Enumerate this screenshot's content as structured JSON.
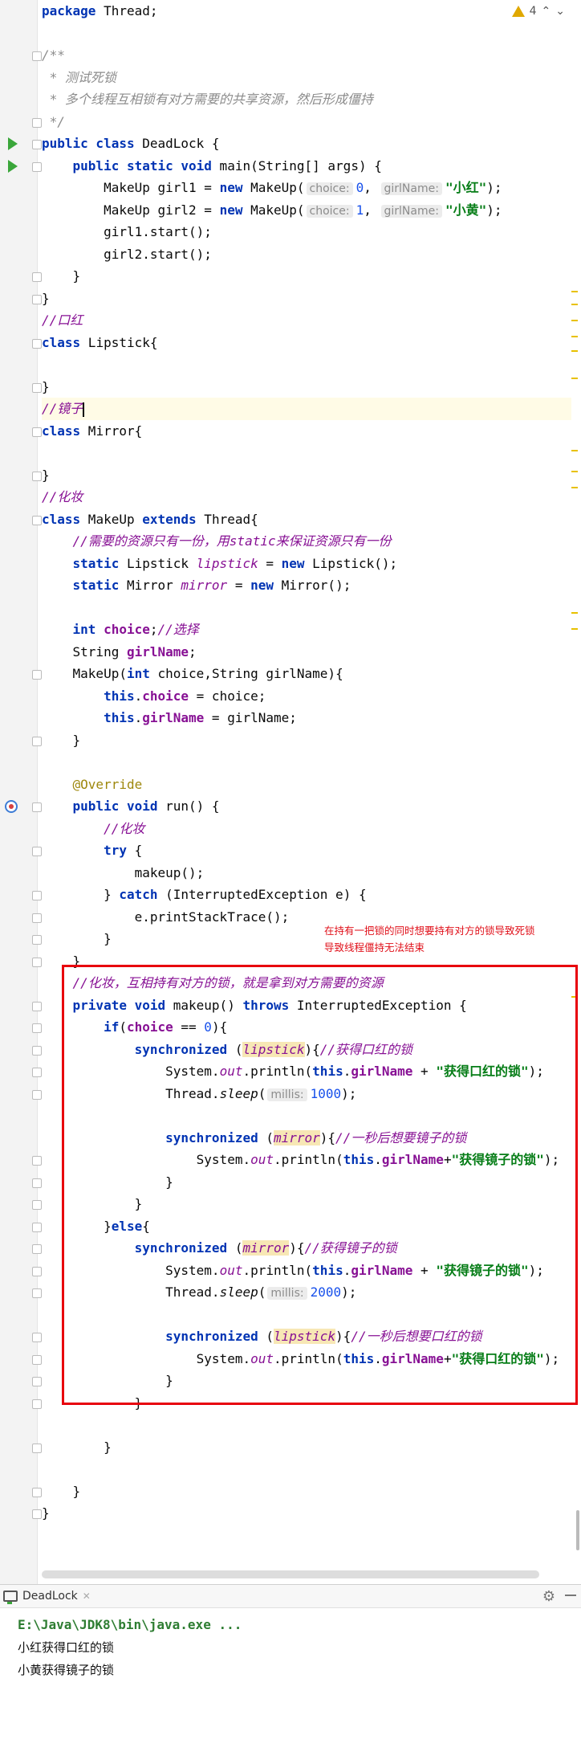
{
  "editor": {
    "warning_count": "4",
    "lines": [
      [
        {
          "t": "package",
          "c": "kw"
        },
        {
          "t": " Thread;"
        }
      ],
      [],
      [
        {
          "t": "/**",
          "c": "cm"
        }
      ],
      [
        {
          "t": " * 测试死锁",
          "c": "cm"
        }
      ],
      [
        {
          "t": " * 多个线程互相锁有对方需要的共享资源，然后形成僵持",
          "c": "cm"
        }
      ],
      [
        {
          "t": " */",
          "c": "cm"
        }
      ],
      [
        {
          "t": "public class",
          "c": "kw"
        },
        {
          "t": " DeadLock {"
        }
      ],
      [
        {
          "t": "    "
        },
        {
          "t": "public static void",
          "c": "kw"
        },
        {
          "t": " main(String[] args) {"
        }
      ],
      [
        {
          "t": "        MakeUp girl1 = "
        },
        {
          "t": "new",
          "c": "kw"
        },
        {
          "t": " MakeUp("
        },
        {
          "t": "choice:",
          "c": "hint"
        },
        {
          "t": "0",
          "c": "num"
        },
        {
          "t": ", "
        },
        {
          "t": "girlName:",
          "c": "hint"
        },
        {
          "t": "\"小红\"",
          "c": "str"
        },
        {
          "t": ");"
        }
      ],
      [
        {
          "t": "        MakeUp girl2 = "
        },
        {
          "t": "new",
          "c": "kw"
        },
        {
          "t": " MakeUp("
        },
        {
          "t": "choice:",
          "c": "hint"
        },
        {
          "t": "1",
          "c": "num"
        },
        {
          "t": ", "
        },
        {
          "t": "girlName:",
          "c": "hint"
        },
        {
          "t": "\"小黄\"",
          "c": "str"
        },
        {
          "t": ");"
        }
      ],
      [
        {
          "t": "        girl1.start();"
        }
      ],
      [
        {
          "t": "        girl2.start();"
        }
      ],
      [
        {
          "t": "    }"
        }
      ],
      [
        {
          "t": "}"
        }
      ],
      [
        {
          "t": "//口红",
          "c": "cmp"
        }
      ],
      [
        {
          "t": "class",
          "c": "kw"
        },
        {
          "t": " Lipstick{"
        }
      ],
      [],
      [
        {
          "t": "}"
        }
      ],
      [
        {
          "t": "//镜子",
          "c": "cmp"
        }
      ],
      [
        {
          "t": "class",
          "c": "kw"
        },
        {
          "t": " Mirror{"
        }
      ],
      [],
      [
        {
          "t": "}"
        }
      ],
      [
        {
          "t": "//化妆",
          "c": "cmp"
        }
      ],
      [
        {
          "t": "class",
          "c": "kw"
        },
        {
          "t": " MakeUp "
        },
        {
          "t": "extends",
          "c": "kw"
        },
        {
          "t": " Thread{"
        }
      ],
      [
        {
          "t": "    "
        },
        {
          "t": "//需要的资源只有一份，用static来保证资源只有一份",
          "c": "cmp"
        }
      ],
      [
        {
          "t": "    "
        },
        {
          "t": "static",
          "c": "kw"
        },
        {
          "t": " Lipstick "
        },
        {
          "t": "lipstick",
          "c": "sfld"
        },
        {
          "t": " = "
        },
        {
          "t": "new",
          "c": "kw"
        },
        {
          "t": " Lipstick();"
        }
      ],
      [
        {
          "t": "    "
        },
        {
          "t": "static",
          "c": "kw"
        },
        {
          "t": " Mirror "
        },
        {
          "t": "mirror",
          "c": "sfld"
        },
        {
          "t": " = "
        },
        {
          "t": "new",
          "c": "kw"
        },
        {
          "t": " Mirror();"
        }
      ],
      [],
      [
        {
          "t": "    "
        },
        {
          "t": "int",
          "c": "kw"
        },
        {
          "t": " "
        },
        {
          "t": "choice",
          "c": "fld"
        },
        {
          "t": ";"
        },
        {
          "t": "//选择",
          "c": "cmp"
        }
      ],
      [
        {
          "t": "    String "
        },
        {
          "t": "girlName",
          "c": "fld"
        },
        {
          "t": ";"
        }
      ],
      [
        {
          "t": "    MakeUp("
        },
        {
          "t": "int",
          "c": "kw"
        },
        {
          "t": " choice,String girlName){"
        }
      ],
      [
        {
          "t": "        "
        },
        {
          "t": "this",
          "c": "kw"
        },
        {
          "t": "."
        },
        {
          "t": "choice",
          "c": "fld"
        },
        {
          "t": " = choice;"
        }
      ],
      [
        {
          "t": "        "
        },
        {
          "t": "this",
          "c": "kw"
        },
        {
          "t": "."
        },
        {
          "t": "girlName",
          "c": "fld"
        },
        {
          "t": " = girlName;"
        }
      ],
      [
        {
          "t": "    }"
        }
      ],
      [],
      [
        {
          "t": "    "
        },
        {
          "t": "@Override",
          "c": "ann"
        }
      ],
      [
        {
          "t": "    "
        },
        {
          "t": "public void",
          "c": "kw"
        },
        {
          "t": " run() {"
        }
      ],
      [
        {
          "t": "        "
        },
        {
          "t": "//化妆",
          "c": "cmp"
        }
      ],
      [
        {
          "t": "        "
        },
        {
          "t": "try",
          "c": "kw"
        },
        {
          "t": " {"
        }
      ],
      [
        {
          "t": "            makeup();"
        }
      ],
      [
        {
          "t": "        } "
        },
        {
          "t": "catch",
          "c": "kw"
        },
        {
          "t": " (InterruptedException e) {"
        }
      ],
      [
        {
          "t": "            e.printStackTrace();"
        }
      ],
      [
        {
          "t": "        }"
        }
      ],
      [
        {
          "t": "    }"
        }
      ],
      [
        {
          "t": "    "
        },
        {
          "t": "//化妆，互相持有对方的锁，就是拿到对方需要的资源",
          "c": "cmp"
        }
      ],
      [
        {
          "t": "    "
        },
        {
          "t": "private void",
          "c": "kw"
        },
        {
          "t": " makeup() "
        },
        {
          "t": "throws",
          "c": "kw"
        },
        {
          "t": " InterruptedException {"
        }
      ],
      [
        {
          "t": "        "
        },
        {
          "t": "if",
          "c": "kw"
        },
        {
          "t": "("
        },
        {
          "t": "choice",
          "c": "fld"
        },
        {
          "t": " == "
        },
        {
          "t": "0",
          "c": "num"
        },
        {
          "t": "){"
        }
      ],
      [
        {
          "t": "            "
        },
        {
          "t": "synchronized",
          "c": "kw"
        },
        {
          "t": " ("
        },
        {
          "t": "lipstick",
          "c": "sfld hl"
        },
        {
          "t": "){"
        },
        {
          "t": "//获得口红的锁",
          "c": "cmp"
        }
      ],
      [
        {
          "t": "                System."
        },
        {
          "t": "out",
          "c": "sfld"
        },
        {
          "t": ".println("
        },
        {
          "t": "this",
          "c": "kw"
        },
        {
          "t": "."
        },
        {
          "t": "girlName",
          "c": "fld"
        },
        {
          "t": " + "
        },
        {
          "t": "\"获得口红的锁\"",
          "c": "str"
        },
        {
          "t": ");"
        }
      ],
      [
        {
          "t": "                Thread."
        },
        {
          "t": "sleep",
          "c": "mth"
        },
        {
          "t": "("
        },
        {
          "t": "millis:",
          "c": "hint"
        },
        {
          "t": "1000",
          "c": "num"
        },
        {
          "t": ");"
        }
      ],
      [],
      [
        {
          "t": "                "
        },
        {
          "t": "synchronized",
          "c": "kw"
        },
        {
          "t": " ("
        },
        {
          "t": "mirror",
          "c": "sfld hl"
        },
        {
          "t": "){"
        },
        {
          "t": "//一秒后想要镜子的锁",
          "c": "cmp"
        }
      ],
      [
        {
          "t": "                    System."
        },
        {
          "t": "out",
          "c": "sfld"
        },
        {
          "t": ".println("
        },
        {
          "t": "this",
          "c": "kw"
        },
        {
          "t": "."
        },
        {
          "t": "girlName",
          "c": "fld"
        },
        {
          "t": "+"
        },
        {
          "t": "\"获得镜子的锁\"",
          "c": "str"
        },
        {
          "t": ");"
        }
      ],
      [
        {
          "t": "                }"
        }
      ],
      [
        {
          "t": "            }"
        }
      ],
      [
        {
          "t": "        }"
        },
        {
          "t": "else",
          "c": "kw"
        },
        {
          "t": "{"
        }
      ],
      [
        {
          "t": "            "
        },
        {
          "t": "synchronized",
          "c": "kw"
        },
        {
          "t": " ("
        },
        {
          "t": "mirror",
          "c": "sfld hl"
        },
        {
          "t": "){"
        },
        {
          "t": "//获得镜子的锁",
          "c": "cmp"
        }
      ],
      [
        {
          "t": "                System."
        },
        {
          "t": "out",
          "c": "sfld"
        },
        {
          "t": ".println("
        },
        {
          "t": "this",
          "c": "kw"
        },
        {
          "t": "."
        },
        {
          "t": "girlName",
          "c": "fld"
        },
        {
          "t": " + "
        },
        {
          "t": "\"获得镜子的锁\"",
          "c": "str"
        },
        {
          "t": ");"
        }
      ],
      [
        {
          "t": "                Thread."
        },
        {
          "t": "sleep",
          "c": "mth"
        },
        {
          "t": "("
        },
        {
          "t": "millis:",
          "c": "hint"
        },
        {
          "t": "2000",
          "c": "num"
        },
        {
          "t": ");"
        }
      ],
      [],
      [
        {
          "t": "                "
        },
        {
          "t": "synchronized",
          "c": "kw"
        },
        {
          "t": " ("
        },
        {
          "t": "lipstick",
          "c": "sfld hl"
        },
        {
          "t": "){"
        },
        {
          "t": "//一秒后想要口红的锁",
          "c": "cmp"
        }
      ],
      [
        {
          "t": "                    System."
        },
        {
          "t": "out",
          "c": "sfld"
        },
        {
          "t": ".println("
        },
        {
          "t": "this",
          "c": "kw"
        },
        {
          "t": "."
        },
        {
          "t": "girlName",
          "c": "fld"
        },
        {
          "t": "+"
        },
        {
          "t": "\"获得口红的锁\"",
          "c": "str"
        },
        {
          "t": ");"
        }
      ],
      [
        {
          "t": "                }"
        }
      ],
      [
        {
          "t": "            }"
        }
      ],
      [],
      [
        {
          "t": "        }"
        }
      ],
      [],
      [
        {
          "t": "    }"
        }
      ],
      [
        {
          "t": "}"
        }
      ]
    ]
  },
  "annotation": {
    "line1": "在持有一把锁的同时想要持有对方的锁导致死锁",
    "line2": "导致线程僵持无法结束"
  },
  "run_panel": {
    "tab_label": "DeadLock",
    "command": "E:\\Java\\JDK8\\bin\\java.exe ...",
    "output": [
      "小红获得口红的锁",
      "小黄获得镜子的锁"
    ]
  }
}
